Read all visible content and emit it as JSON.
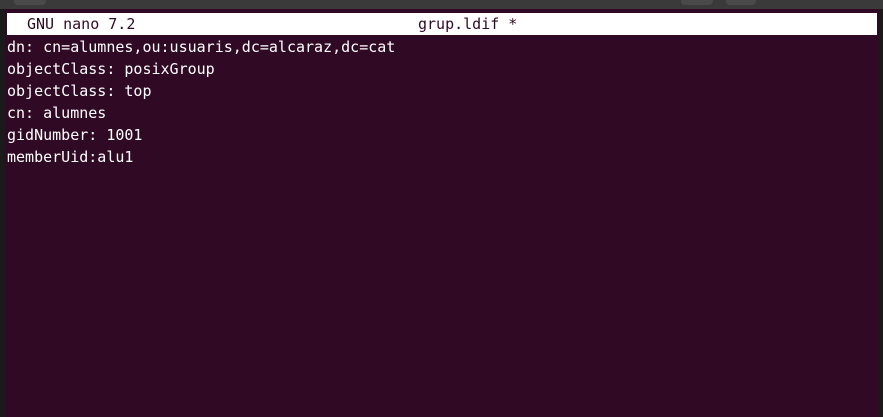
{
  "nano": {
    "app_title": "GNU nano 7.2",
    "file_title": "grup.ldif *"
  },
  "file_lines": [
    "dn: cn=alumnes,ou:usuaris,dc=alcaraz,dc=cat",
    "objectClass: posixGroup",
    "objectClass: top",
    "cn: alumnes",
    "gidNumber: 1001",
    "memberUid:alu1"
  ],
  "colors": {
    "terminal_background": "#300a24",
    "titlebar_background": "#ffffff",
    "text": "#ffffff"
  }
}
